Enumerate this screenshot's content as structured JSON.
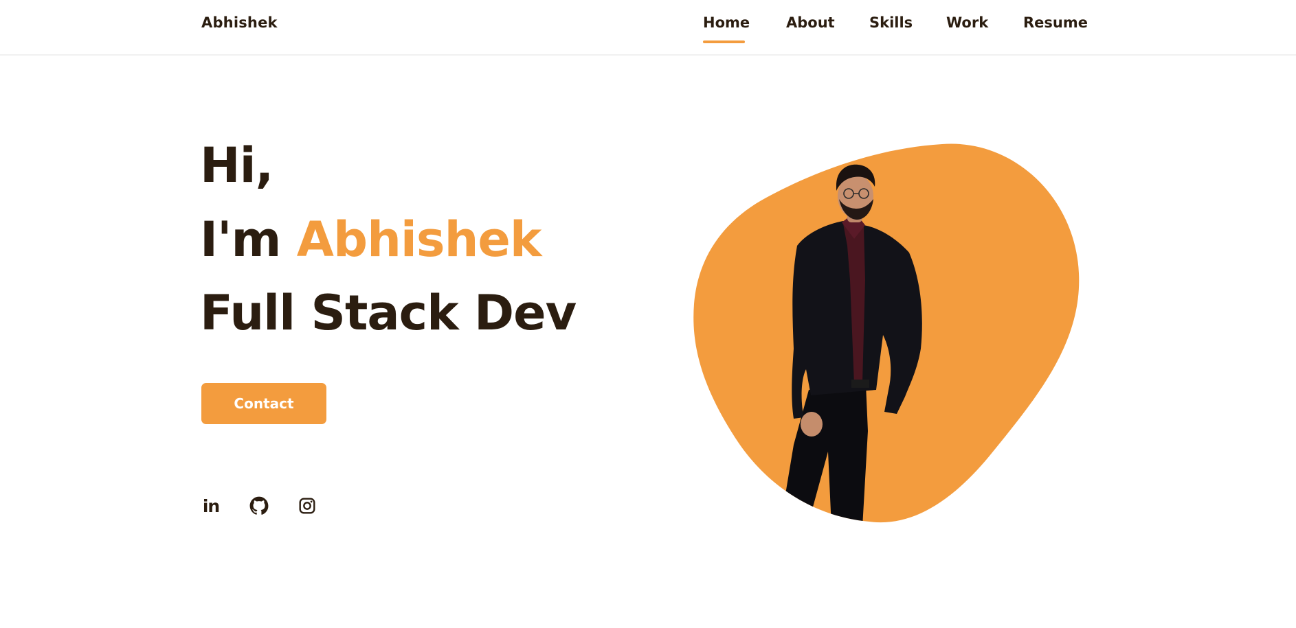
{
  "header": {
    "logo": "Abhishek",
    "nav": [
      {
        "label": "Home",
        "active": true
      },
      {
        "label": "About",
        "active": false
      },
      {
        "label": "Skills",
        "active": false
      },
      {
        "label": "Work",
        "active": false
      },
      {
        "label": "Resume",
        "active": false
      }
    ]
  },
  "hero": {
    "greeting": "Hi,",
    "intro_prefix": "I'm",
    "name": "Abhishek",
    "role": "Full Stack Dev",
    "contact_label": "Contact"
  },
  "social": {
    "linkedin_glyph": "in",
    "icons": [
      "linkedin-icon",
      "github-icon",
      "instagram-icon"
    ]
  },
  "portrait": {
    "icon": "profile-photo"
  },
  "colors": {
    "accent": "#f39c3e",
    "text_dark": "#2b1d10",
    "background": "#ffffff"
  }
}
